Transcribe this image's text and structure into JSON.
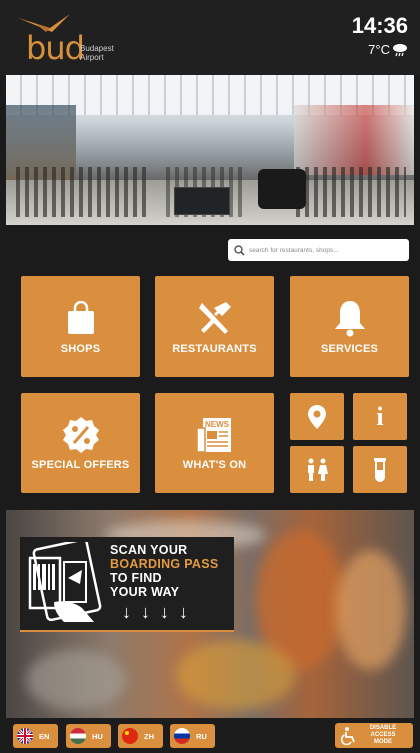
{
  "header": {
    "logo_text": "bud",
    "logo_sub_line1": "Budapest",
    "logo_sub_line2": "Airport",
    "time": "14:36",
    "temperature": "7°C",
    "weather_icon": "cloud-rain-icon"
  },
  "search": {
    "placeholder": "search for restaurants, shops..."
  },
  "tiles": {
    "shops": "SHOPS",
    "restaurants": "RESTAURANTS",
    "services": "SERVICES",
    "special_offers": "SPECIAL OFFERS",
    "whats_on": "WHAT'S ON",
    "whats_on_icon_text": "NEWS"
  },
  "small_tiles": {
    "map_icon": "map-pin-icon",
    "info": "i",
    "toilets_icon": "toilets-icon",
    "lab_icon": "test-tube-icon"
  },
  "promo": {
    "line1": "SCAN YOUR",
    "line2": "BOARDING PASS",
    "line3": "TO FIND",
    "line4": "YOUR WAY",
    "arrows": [
      "↓",
      "↓",
      "↓",
      "↓"
    ]
  },
  "languages": [
    {
      "code": "EN",
      "flag": "uk-flag-icon"
    },
    {
      "code": "HU",
      "flag": "hungary-flag-icon"
    },
    {
      "code": "ZH",
      "flag": "china-flag-icon"
    },
    {
      "code": "RU",
      "flag": "russia-flag-icon"
    }
  ],
  "access": {
    "line1": "DISABLE",
    "line2": "ACCESS MODE"
  },
  "colors": {
    "accent": "#d98f3d",
    "background": "#1b1b1b",
    "highlight": "#e39a3f"
  }
}
